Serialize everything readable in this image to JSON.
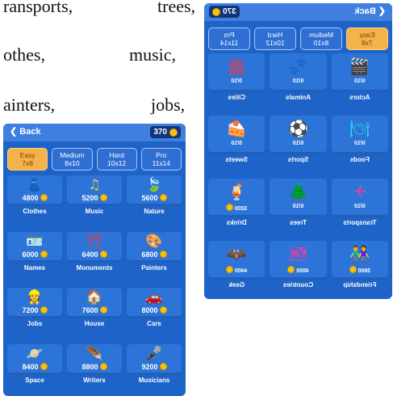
{
  "prose": {
    "line1": "ransports,",
    "line1b": "trees,",
    "line2": "othes,",
    "line2b": "music,",
    "line3": "ainters,",
    "line3b": "jobs,"
  },
  "right_screen": {
    "back_label": "Back",
    "coin_count": "370",
    "tabs": [
      {
        "label": "Easy",
        "size": "7x8"
      },
      {
        "label": "Medium",
        "size": "8x10"
      },
      {
        "label": "Hard",
        "size": "10x12"
      },
      {
        "label": "Pro",
        "size": "11x14"
      }
    ],
    "cards": [
      {
        "label": "Actors",
        "value": "0/10",
        "icon": "clapperboard-icon",
        "glyph": "🎬",
        "color": "#f2f2f2"
      },
      {
        "label": "Animals",
        "value": "0/10",
        "icon": "paw-icon",
        "glyph": "🐾",
        "color": "#29d3e6"
      },
      {
        "label": "Cities",
        "value": "0/10",
        "icon": "building-icon",
        "glyph": "🏛",
        "color": "#e23b52"
      },
      {
        "label": "Foods",
        "value": "0/10",
        "icon": "dish-icon",
        "glyph": "🍽",
        "color": "#2ad3e0"
      },
      {
        "label": "Sports",
        "value": "0/10",
        "icon": "soccer-ball-icon",
        "glyph": "⚽",
        "color": "#2ad3e0"
      },
      {
        "label": "Sweets",
        "value": "0/10",
        "icon": "cake-icon",
        "glyph": "🍰",
        "color": "#ee3f6c"
      },
      {
        "label": "Transports",
        "value": "0/10",
        "icon": "airplane-icon",
        "glyph": "✈",
        "color": "#e63f9f"
      },
      {
        "label": "Trees",
        "value": "0/10",
        "icon": "tree-icon",
        "glyph": "🌲",
        "color": "#ee3c4e"
      },
      {
        "label": "Drinks",
        "value": "3200",
        "icon": "cocktail-icon",
        "glyph": "🍹",
        "color": "#f0c33a"
      },
      {
        "label": "Friendship",
        "value": "3600",
        "icon": "friends-icon",
        "glyph": "👫",
        "color": "#f37ac6"
      },
      {
        "label": "Countries",
        "value": "4000",
        "icon": "map-icon",
        "glyph": "🗺",
        "color": "#e63f9f"
      },
      {
        "label": "Geek",
        "value": "4400",
        "icon": "mask-icon",
        "glyph": "🦇",
        "color": "#2ad3e0"
      }
    ]
  },
  "left_screen": {
    "back_label": "Back",
    "coin_count": "370",
    "tabs": [
      {
        "label": "Easy",
        "size": "7x8"
      },
      {
        "label": "Medium",
        "size": "8x10"
      },
      {
        "label": "Hard",
        "size": "10x12"
      },
      {
        "label": "Pro",
        "size": "11x14"
      }
    ],
    "cards": [
      {
        "label": "Clothes",
        "value": "4800",
        "icon": "dress-icon",
        "glyph": "👗",
        "color": "#f4c33a"
      },
      {
        "label": "Music",
        "value": "5200",
        "icon": "music-notes-icon",
        "glyph": "♫",
        "color": "#f4c33a"
      },
      {
        "label": "Nature",
        "value": "5600",
        "icon": "leaf-icon",
        "glyph": "🍃",
        "color": "#b46de6"
      },
      {
        "label": "Names",
        "value": "6000",
        "icon": "id-card-icon",
        "glyph": "🪪",
        "color": "#2ad3e0"
      },
      {
        "label": "Monuments",
        "value": "6400",
        "icon": "gate-icon",
        "glyph": "⛩",
        "color": "#e23b52"
      },
      {
        "label": "Painters",
        "value": "6800",
        "icon": "palette-icon",
        "glyph": "🎨",
        "color": "#ee5b4a"
      },
      {
        "label": "Jobs",
        "value": "7200",
        "icon": "worker-icon",
        "glyph": "👷",
        "color": "#f4c33a"
      },
      {
        "label": "House",
        "value": "7600",
        "icon": "house-icon",
        "glyph": "🏠",
        "color": "#e63f9f"
      },
      {
        "label": "Cars",
        "value": "8000",
        "icon": "car-icon",
        "glyph": "🚗",
        "color": "#ee3f6c"
      },
      {
        "label": "Space",
        "value": "8400",
        "icon": "planet-icon",
        "glyph": "🪐",
        "color": "#ee3f5c"
      },
      {
        "label": "Writers",
        "value": "8800",
        "icon": "quill-icon",
        "glyph": "🪶",
        "color": "#f4c33a"
      },
      {
        "label": "Musicians",
        "value": "9200",
        "icon": "musician-icon",
        "glyph": "🎤",
        "color": "#2ad3e0"
      }
    ]
  }
}
